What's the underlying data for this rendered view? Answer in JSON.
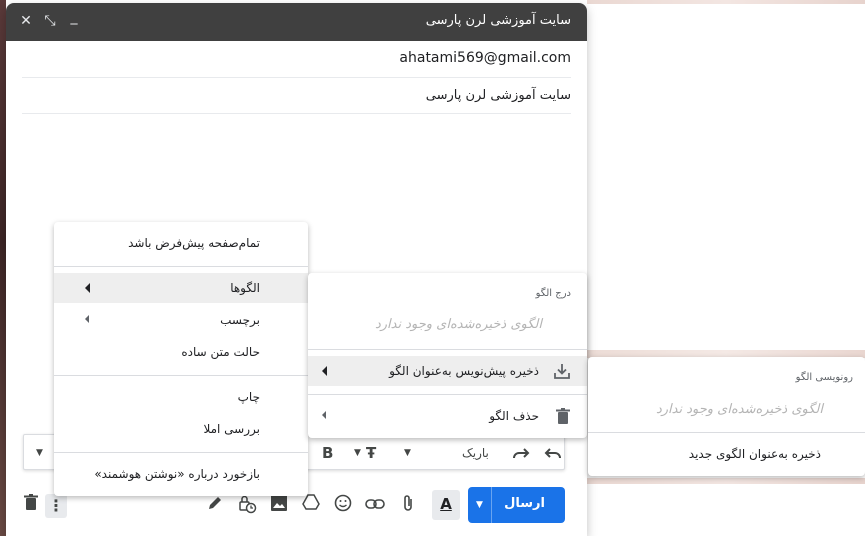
{
  "compose": {
    "title": "سایت آموزشی لرن پارسی",
    "recipient": "ahatami569@gmail.com",
    "subject": "سایت آموزشی لرن پارسی",
    "header_icons": [
      "close-icon",
      "fullscreen-icon",
      "minimize-icon"
    ]
  },
  "format_bar": {
    "font_name": "باریک",
    "icons": [
      "undo-icon",
      "redo-icon",
      "font-size-icon",
      "bold-icon"
    ]
  },
  "bottom_bar": {
    "send_label": "ارسال",
    "format_letter": "A",
    "icons": [
      "attach-icon",
      "link-icon",
      "emoji-icon",
      "drive-icon",
      "photo-icon",
      "confidential-icon",
      "signature-icon",
      "more-options-icon",
      "trash-icon"
    ]
  },
  "more_menu": {
    "fullscreen_default": "تمام‌صفحه پیش‌فرض باشد",
    "templates": "الگوها",
    "label": "برچسب",
    "plain_text": "حالت متن ساده",
    "print": "چاپ",
    "spellcheck": "بررسی املا",
    "feedback": "بازخورد درباره «نوشتن هوشمند»"
  },
  "templates_menu": {
    "insert_heading": "درج الگو",
    "no_saved_1": "الگوی ذخیره‌شده‌ای وجود ندارد",
    "save_draft": "ذخیره پیش‌نویس به‌عنوان الگو",
    "delete_template": "حذف الگو"
  },
  "save_menu": {
    "overwrite_heading": "رونویسی الگو",
    "no_saved_2": "الگوی ذخیره‌شده‌ای وجود ندارد",
    "save_new": "ذخیره به‌عنوان الگوی جدید"
  }
}
